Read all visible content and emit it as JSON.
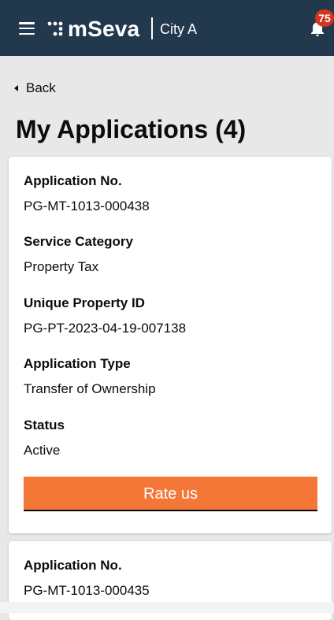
{
  "header": {
    "brand": "mSeva",
    "city": "City A",
    "notification_count": "75",
    "colors": {
      "background": "#22394d",
      "badge": "#d4351c"
    },
    "icons": [
      "menu-icon",
      "mseva-logo-icon",
      "bell-icon"
    ]
  },
  "nav": {
    "back_label": "Back"
  },
  "page": {
    "title": "My Applications (4)"
  },
  "applications": [
    {
      "app_no_label": "Application No.",
      "app_no": "PG-MT-1013-000438",
      "service_category_label": "Service Category",
      "service_category": "Property Tax",
      "property_id_label": "Unique Property ID",
      "property_id": "PG-PT-2023-04-19-007138",
      "app_type_label": "Application Type",
      "app_type": "Transfer of Ownership",
      "status_label": "Status",
      "status": "Active",
      "action_label": "Rate us"
    },
    {
      "app_no_label": "Application No.",
      "app_no": "PG-MT-1013-000435"
    }
  ],
  "colors": {
    "accent": "#f47738",
    "page_background": "#e8e8e8"
  }
}
